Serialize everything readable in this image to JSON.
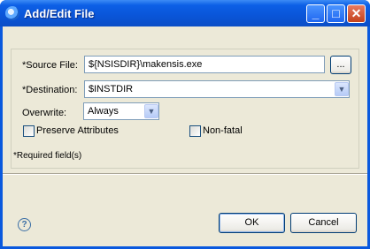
{
  "window": {
    "title": "Add/Edit File",
    "controls": {
      "minimize": "_",
      "maximize": "□",
      "close": "✕"
    }
  },
  "form": {
    "source_file": {
      "label": "*Source File:",
      "value": "${NSISDIR}\\makensis.exe",
      "browse_label": "..."
    },
    "destination": {
      "label": "*Destination:",
      "value": "$INSTDIR"
    },
    "overwrite": {
      "label": "Overwrite:",
      "value": "Always"
    },
    "preserve_attributes": {
      "label": "Preserve Attributes",
      "checked": false
    },
    "non_fatal": {
      "label": "Non-fatal",
      "checked": false
    },
    "required_note": "*Required field(s)"
  },
  "footer": {
    "help_icon": "?",
    "ok_label": "OK",
    "cancel_label": "Cancel"
  },
  "icons": [
    "app-icon",
    "minimize-icon",
    "maximize-icon",
    "close-icon",
    "chevron-down-icon",
    "help-icon"
  ]
}
